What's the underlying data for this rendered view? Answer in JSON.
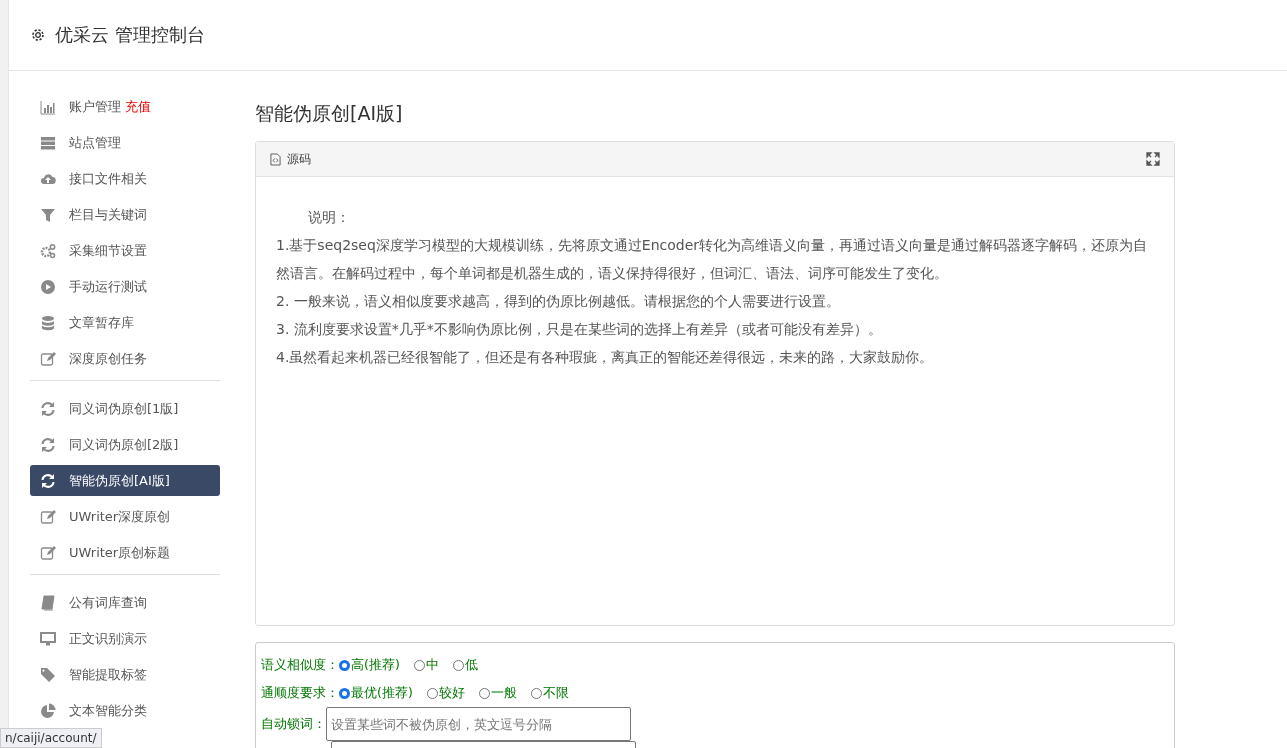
{
  "header": {
    "title": "优采云 管理控制台"
  },
  "sidebar": {
    "groups": [
      {
        "items": [
          {
            "label": "账户管理",
            "badge": "充值",
            "selected": false
          },
          {
            "label": "站点管理",
            "selected": false
          },
          {
            "label": "接口文件相关",
            "selected": false
          },
          {
            "label": "栏目与关键词",
            "selected": false
          },
          {
            "label": "采集细节设置",
            "selected": false
          },
          {
            "label": "手动运行测试",
            "selected": false
          },
          {
            "label": "文章暂存库",
            "selected": false
          },
          {
            "label": "深度原创任务",
            "selected": false
          }
        ]
      },
      {
        "items": [
          {
            "label": "同义词伪原创[1版]",
            "selected": false
          },
          {
            "label": "同义词伪原创[2版]",
            "selected": false
          },
          {
            "label": "智能伪原创[AI版]",
            "selected": true
          },
          {
            "label": "UWriter深度原创",
            "selected": false
          },
          {
            "label": "UWriter原创标题",
            "selected": false
          }
        ]
      },
      {
        "items": [
          {
            "label": "公有词库查询",
            "selected": false
          },
          {
            "label": "正文识别演示",
            "selected": false
          },
          {
            "label": "智能提取标签",
            "selected": false
          },
          {
            "label": "文本智能分类",
            "selected": false
          }
        ]
      }
    ]
  },
  "page_title": "智能伪原创[AI版]",
  "editor": {
    "toolbar_label": "源码",
    "paragraphs": [
      "说明：",
      "1.基于seq2seq深度学习模型的大规模训练，先将原文通过Encoder转化为高维语义向量，再通过语义向量是通过解码器逐字解码，还原为自然语言。在解码过程中，每个单词都是机器生成的，语义保持得很好，但词汇、语法、词序可能发生了变化。",
      "2. 一般来说，语义相似度要求越高，得到的伪原比例越低。请根据您的个人需要进行设置。",
      "3. 流利度要求设置*几乎*不影响伪原比例，只是在某些词的选择上有差异（或者可能没有差异）。",
      "4.虽然看起来机器已经很智能了，但还是有各种瑕疵，离真正的智能还差得很远，未来的路，大家鼓励你。"
    ]
  },
  "options": {
    "radio_groups": [
      {
        "label": "语义相似度：",
        "choices": [
          {
            "label": "高(推荐)",
            "selected": true
          },
          {
            "label": "中",
            "selected": false
          },
          {
            "label": "低",
            "selected": false
          }
        ]
      },
      {
        "label": "通顺度要求：",
        "choices": [
          {
            "label": "最优(推荐)",
            "selected": true
          },
          {
            "label": "较好",
            "selected": false
          },
          {
            "label": "一般",
            "selected": false
          },
          {
            "label": "不限",
            "selected": false
          }
        ]
      }
    ],
    "lock_words": {
      "label": "自动锁词：",
      "placeholder": "设置某些词不被伪原创，英文逗号分隔"
    }
  },
  "status_bar": {
    "url": "n/caiji/account/"
  }
}
